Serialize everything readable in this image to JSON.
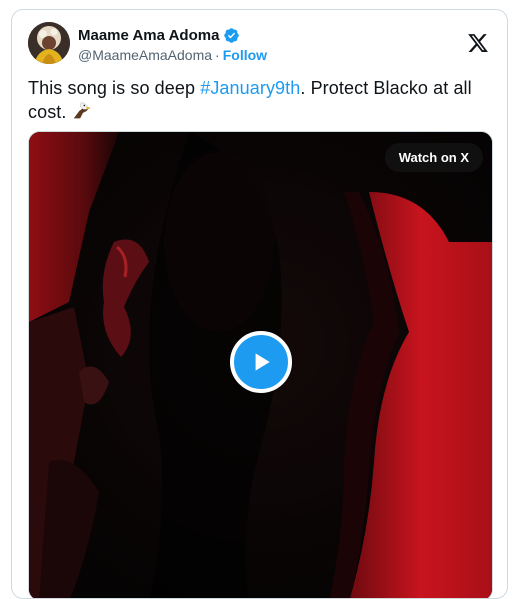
{
  "author": {
    "display_name": "Maame Ama Adoma",
    "handle": "@MaameAmaAdoma",
    "separator": "·",
    "follow_label": "Follow"
  },
  "tweet": {
    "text_before": "This song is so deep ",
    "hashtag": "#January9th",
    "text_after": ". Protect Blacko at all cost.",
    "emoji": "eagle"
  },
  "media": {
    "watch_label": "Watch on X"
  },
  "icons": {
    "verified": "verified-badge-icon",
    "x_logo": "x-logo-icon",
    "play": "play-icon"
  },
  "colors": {
    "accent": "#1d9bf0",
    "text": "#0f1419",
    "muted": "#536471",
    "border": "#cfd9de",
    "media_red": "#b3141c"
  }
}
